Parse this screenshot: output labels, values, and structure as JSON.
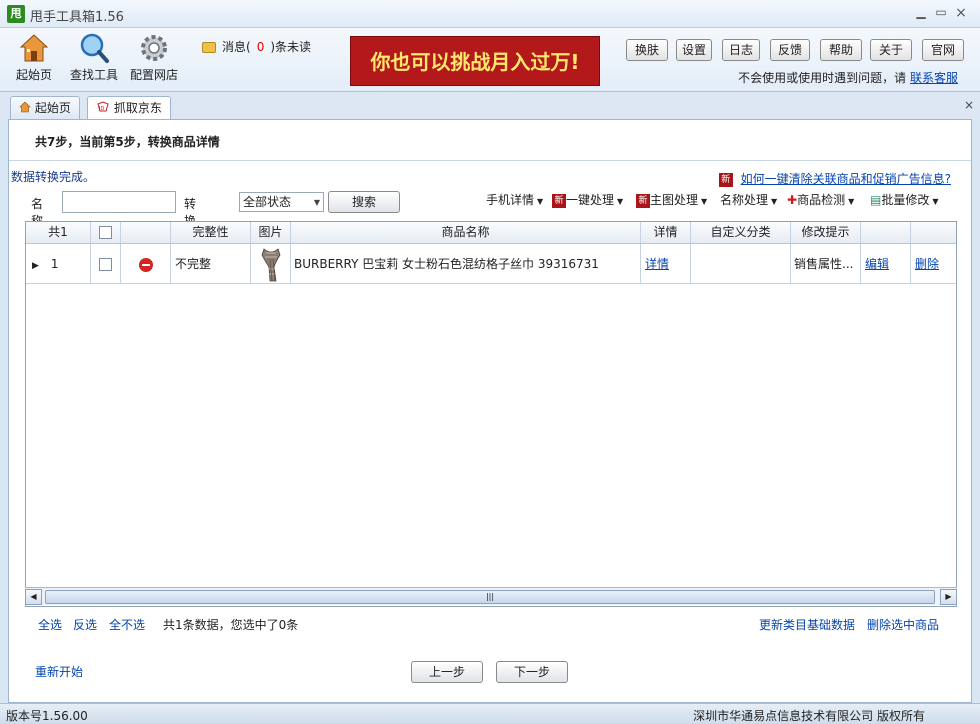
{
  "window": {
    "title": "甩手工具箱1.56",
    "app_icon": "甩",
    "minimize": "▁",
    "maximize": "▭",
    "close": "×"
  },
  "toolbar": {
    "tools": [
      {
        "label": "起始页",
        "icon": "house-icon"
      },
      {
        "label": "查找工具",
        "icon": "magnifier-icon"
      },
      {
        "label": "配置网店",
        "icon": "gear-icon"
      }
    ],
    "message": {
      "prefix": "消息(",
      "count": "0",
      "suffix": ")条未读"
    },
    "banner": "你也可以挑战月入过万!",
    "buttons": [
      "换肤",
      "设置",
      "日志",
      "反馈",
      "帮助",
      "关于",
      "官网"
    ],
    "help_text": "不会使用或使用时遇到问题，请",
    "help_link": "联系客服"
  },
  "tabs": [
    {
      "label": "起始页",
      "icon": "house-icon",
      "active": false
    },
    {
      "label": "抓取京东",
      "icon": "jd-logo-icon",
      "active": true
    }
  ],
  "tab_close": "×",
  "main": {
    "step_title": "共7步，当前第5步，转换商品详情",
    "status": "数据转换完成。",
    "faq_badge": "新",
    "faq_link": "如何一键清除关联商品和促销广告信息?",
    "filter": {
      "name_label": "名称",
      "name_value": "",
      "state_label": "转换状态",
      "state_value": "全部状态",
      "search_button": "搜索"
    },
    "actions": [
      {
        "label": "手机详情",
        "badge": ""
      },
      {
        "label": "一键处理",
        "badge": "新"
      },
      {
        "label": "主图处理",
        "badge": "新"
      },
      {
        "label": "名称处理",
        "badge": ""
      },
      {
        "label": "商品检测",
        "badge": "✚"
      },
      {
        "label": "批量修改",
        "badge": "▤"
      }
    ],
    "grid": {
      "columns": [
        "共1",
        "",
        "",
        "完整性",
        "图片",
        "商品名称",
        "详情",
        "自定义分类",
        "修改提示",
        "",
        ""
      ],
      "rows": [
        {
          "num": "1",
          "integrity": "不完整",
          "name": "BURBERRY 巴宝莉 女士粉石色混纺格子丝巾 39316731",
          "detail": "详情",
          "category": "",
          "hint": "销售属性...",
          "edit": "编辑",
          "delete": "删除"
        }
      ]
    },
    "bottom": {
      "select_all": "全选",
      "invert": "反选",
      "select_none": "全不选",
      "summary": "共1条数据，您选中了0条",
      "update_link": "更新类目基础数据",
      "delete_selected": "删除选中商品",
      "restart": "重新开始",
      "prev": "上一步",
      "next": "下一步"
    }
  },
  "statusbar": {
    "version": "版本号1.56.00",
    "copyright": "深圳市华通易点信息技术有限公司 版权所有"
  }
}
